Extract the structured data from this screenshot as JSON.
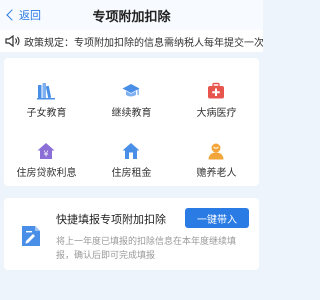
{
  "header": {
    "back_label": "返回",
    "title": "专项附加扣除"
  },
  "notice": {
    "text": "政策规定：专项附加扣除的信息需纳税人每年提交一次"
  },
  "categories": [
    {
      "label": "子女教育",
      "icon": "children-education-icon",
      "color": "#4a8fe7"
    },
    {
      "label": "继续教育",
      "icon": "graduation-cap-icon",
      "color": "#4a8fe7"
    },
    {
      "label": "大病医疗",
      "icon": "medical-kit-icon",
      "color": "#e8554e"
    },
    {
      "label": "住房贷款利息",
      "icon": "house-loan-icon",
      "color": "#8b6fd6"
    },
    {
      "label": "住房租金",
      "icon": "house-rent-icon",
      "color": "#4a8fe7"
    },
    {
      "label": "赡养老人",
      "icon": "elderly-support-icon",
      "color": "#f2a53a"
    }
  ],
  "quick_fill": {
    "title": "快捷填报专项附加扣除",
    "button_label": "一键带入",
    "description": "将上一年度已填报的扣除信息在本年度继续填报，确认后即可完成填报"
  }
}
